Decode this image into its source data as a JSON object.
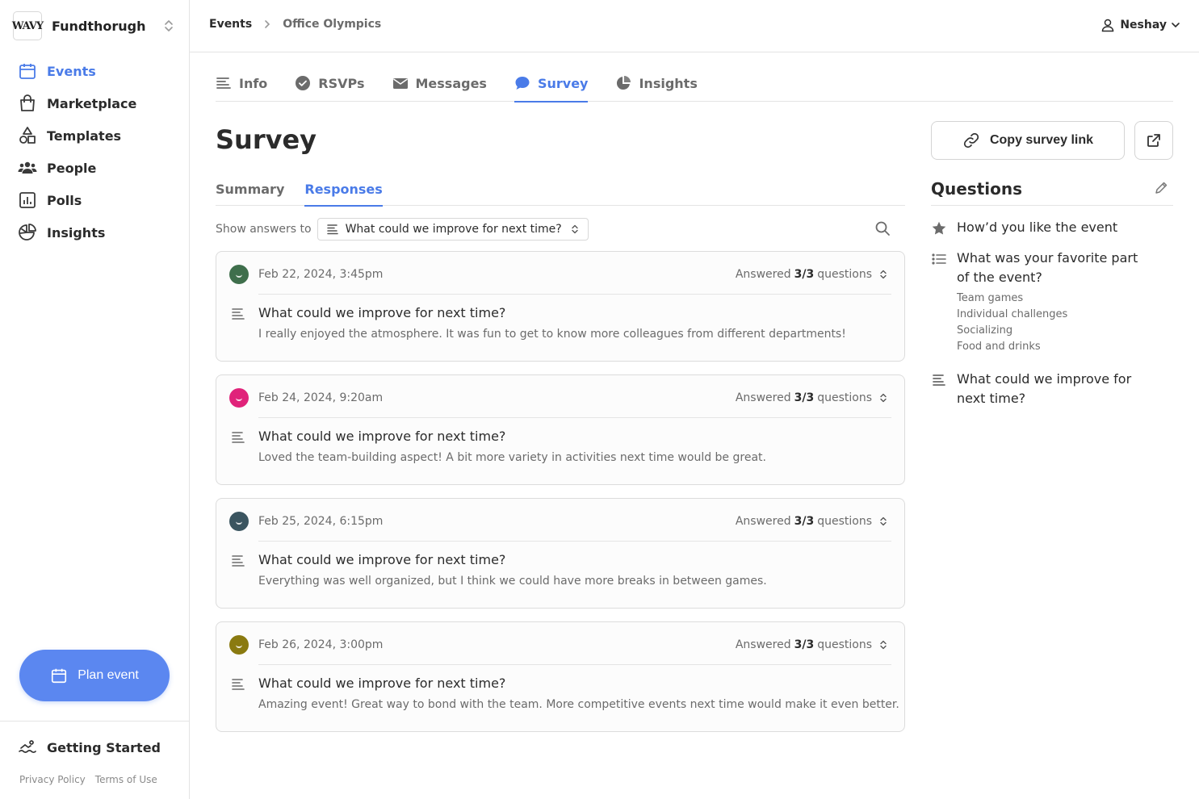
{
  "org": {
    "logo_text": "WAVY",
    "name": "Fundthorugh"
  },
  "nav": [
    {
      "label": "Events",
      "icon": "calendar-icon",
      "active": true
    },
    {
      "label": "Marketplace",
      "icon": "shopping-bag-icon"
    },
    {
      "label": "Templates",
      "icon": "shapes-icon"
    },
    {
      "label": "People",
      "icon": "people-icon"
    },
    {
      "label": "Polls",
      "icon": "poll-chart-icon"
    },
    {
      "label": "Insights",
      "icon": "pie-chart-icon"
    }
  ],
  "plan_button": "Plan event",
  "getting_started": "Getting Started",
  "legal": {
    "privacy": "Privacy Policy",
    "terms": "Terms of Use"
  },
  "breadcrumb": {
    "root": "Events",
    "current": "Office Olympics"
  },
  "user": {
    "name": "Neshay"
  },
  "tabs": [
    {
      "label": "Info",
      "icon": "text-lines-icon"
    },
    {
      "label": "RSVPs",
      "icon": "check-circle-icon"
    },
    {
      "label": "Messages",
      "icon": "envelope-icon"
    },
    {
      "label": "Survey",
      "icon": "chat-bubble-icon",
      "active": true
    },
    {
      "label": "Insights",
      "icon": "pie-chart-icon"
    }
  ],
  "page_title": "Survey",
  "sub_tabs": {
    "summary": "Summary",
    "responses": "Responses"
  },
  "filter": {
    "label": "Show answers to",
    "selected": "What could we improve for next time?"
  },
  "responses": [
    {
      "date": "Feb 22, 2024, 3:45pm",
      "answered_prefix": "Answered",
      "answered_count": "3/3",
      "answered_suffix": "questions",
      "question": "What could we improve for next time?",
      "answer": "I really enjoyed the atmosphere. It was fun to get to know more colleagues from different departments!",
      "avatar_color": "#3f6f4c"
    },
    {
      "date": "Feb 24, 2024, 9:20am",
      "answered_prefix": "Answered",
      "answered_count": "3/3",
      "answered_suffix": "questions",
      "question": "What could we improve for next time?",
      "answer": "Loved the team-building aspect! A bit more variety in activities next time would be great.",
      "avatar_color": "#e0237a"
    },
    {
      "date": "Feb 25, 2024, 6:15pm",
      "answered_prefix": "Answered",
      "answered_count": "3/3",
      "answered_suffix": "questions",
      "question": "What could we improve for next time?",
      "answer": "Everything was well organized, but I think we could have more breaks in between games.",
      "avatar_color": "#3b5560"
    },
    {
      "date": "Feb 26, 2024, 3:00pm",
      "answered_prefix": "Answered",
      "answered_count": "3/3",
      "answered_suffix": "questions",
      "question": "What could we improve for next time?",
      "answer": "Amazing event! Great way to bond with the team. More competitive events next time would make it even better.",
      "avatar_color": "#8a7a10"
    }
  ],
  "copy_link": "Copy survey link",
  "questions_title": "Questions",
  "questions": [
    {
      "text": "How’d you like the event",
      "icon": "star-icon"
    },
    {
      "text": "What was your favorite part of the event?",
      "icon": "list-icon",
      "options": [
        "Team games",
        "Individual challenges",
        "Socializing",
        "Food and drinks"
      ]
    },
    {
      "text": "What could we improve for next time?",
      "icon": "text-lines-icon"
    }
  ],
  "colors": {
    "accent": "#4a7be8",
    "plan_button": "#5b87f0"
  }
}
